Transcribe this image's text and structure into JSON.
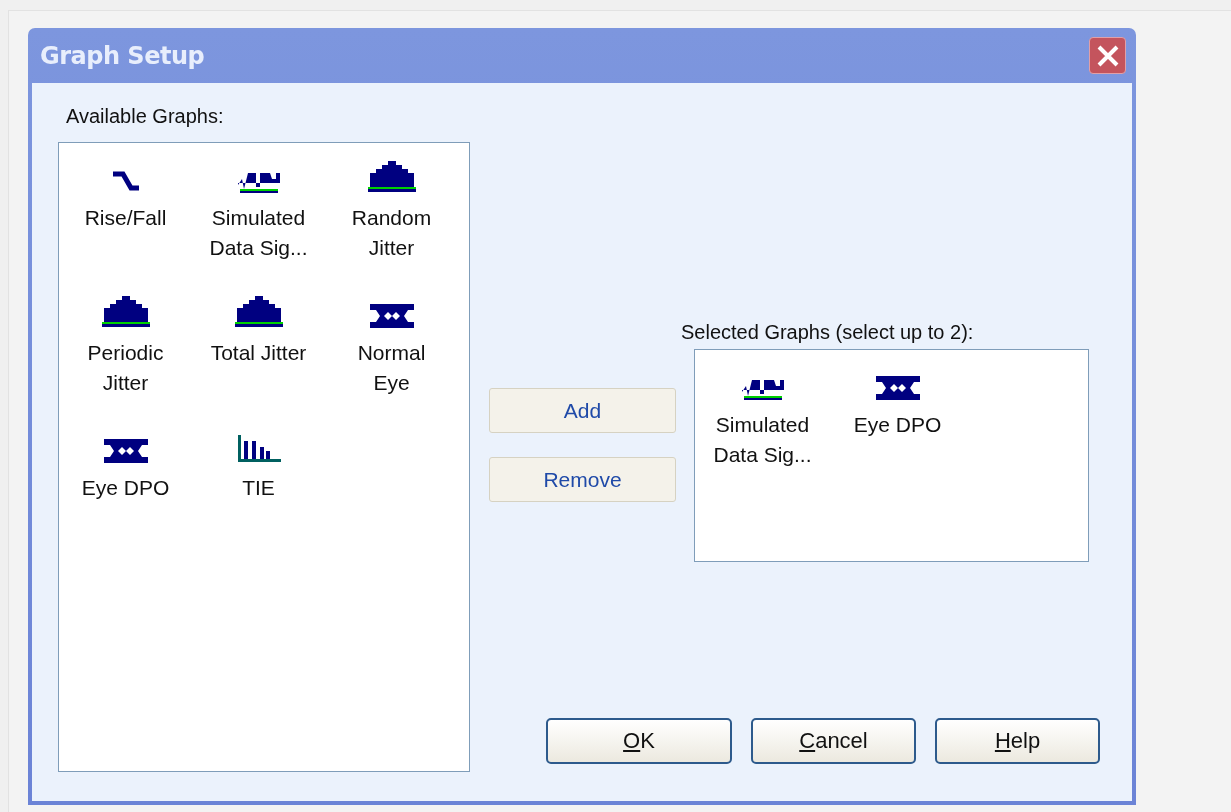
{
  "window": {
    "title": "Graph Setup"
  },
  "available": {
    "label": "Available Graphs:",
    "items": [
      {
        "kind": "edge",
        "lines": [
          "Rise/Fall"
        ]
      },
      {
        "kind": "signal",
        "lines": [
          "Simulated",
          "Data Sig..."
        ]
      },
      {
        "kind": "histogram",
        "lines": [
          "Random",
          "Jitter"
        ]
      },
      {
        "kind": "histogram",
        "lines": [
          "Periodic",
          "Jitter"
        ]
      },
      {
        "kind": "histogram",
        "lines": [
          "Total Jitter"
        ]
      },
      {
        "kind": "eye",
        "lines": [
          "Normal",
          "Eye"
        ]
      },
      {
        "kind": "eye",
        "lines": [
          "Eye DPO"
        ]
      },
      {
        "kind": "bars",
        "lines": [
          "TIE"
        ]
      }
    ]
  },
  "actions": [
    "Add",
    "Remove"
  ],
  "selected": {
    "label": "Selected Graphs (select up to 2):",
    "items": [
      {
        "kind": "signal",
        "lines": [
          "Simulated",
          "Data Sig..."
        ]
      },
      {
        "kind": "eye",
        "lines": [
          "Eye DPO"
        ]
      }
    ]
  },
  "buttons": [
    {
      "mnemonic": "O",
      "rest": "K"
    },
    {
      "mnemonic": "C",
      "rest": "ancel"
    },
    {
      "mnemonic": "H",
      "rest": "elp"
    }
  ]
}
